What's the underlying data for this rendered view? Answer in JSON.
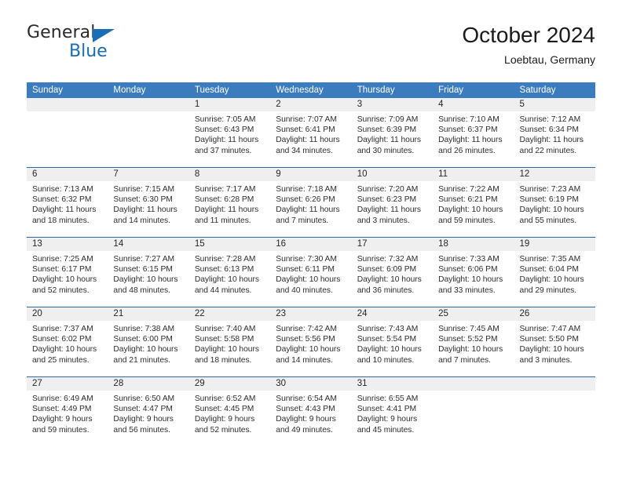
{
  "logo": {
    "word_dark": "General",
    "word_blue": "Blue",
    "triangle_color": "#1a6eb5"
  },
  "header": {
    "title": "October 2024",
    "subtitle": "Loebtau, Germany"
  },
  "theme": {
    "header_blue": "#3b7cbf",
    "divider_blue": "#2a66a8",
    "daynum_band": "#efefef",
    "text": "#2e2e2e"
  },
  "weekdays": [
    "Sunday",
    "Monday",
    "Tuesday",
    "Wednesday",
    "Thursday",
    "Friday",
    "Saturday"
  ],
  "weeks": [
    [
      {
        "day": "",
        "lines": []
      },
      {
        "day": "",
        "lines": []
      },
      {
        "day": "1",
        "lines": [
          "Sunrise: 7:05 AM",
          "Sunset: 6:43 PM",
          "Daylight: 11 hours",
          "and 37 minutes."
        ]
      },
      {
        "day": "2",
        "lines": [
          "Sunrise: 7:07 AM",
          "Sunset: 6:41 PM",
          "Daylight: 11 hours",
          "and 34 minutes."
        ]
      },
      {
        "day": "3",
        "lines": [
          "Sunrise: 7:09 AM",
          "Sunset: 6:39 PM",
          "Daylight: 11 hours",
          "and 30 minutes."
        ]
      },
      {
        "day": "4",
        "lines": [
          "Sunrise: 7:10 AM",
          "Sunset: 6:37 PM",
          "Daylight: 11 hours",
          "and 26 minutes."
        ]
      },
      {
        "day": "5",
        "lines": [
          "Sunrise: 7:12 AM",
          "Sunset: 6:34 PM",
          "Daylight: 11 hours",
          "and 22 minutes."
        ]
      }
    ],
    [
      {
        "day": "6",
        "lines": [
          "Sunrise: 7:13 AM",
          "Sunset: 6:32 PM",
          "Daylight: 11 hours",
          "and 18 minutes."
        ]
      },
      {
        "day": "7",
        "lines": [
          "Sunrise: 7:15 AM",
          "Sunset: 6:30 PM",
          "Daylight: 11 hours",
          "and 14 minutes."
        ]
      },
      {
        "day": "8",
        "lines": [
          "Sunrise: 7:17 AM",
          "Sunset: 6:28 PM",
          "Daylight: 11 hours",
          "and 11 minutes."
        ]
      },
      {
        "day": "9",
        "lines": [
          "Sunrise: 7:18 AM",
          "Sunset: 6:26 PM",
          "Daylight: 11 hours",
          "and 7 minutes."
        ]
      },
      {
        "day": "10",
        "lines": [
          "Sunrise: 7:20 AM",
          "Sunset: 6:23 PM",
          "Daylight: 11 hours",
          "and 3 minutes."
        ]
      },
      {
        "day": "11",
        "lines": [
          "Sunrise: 7:22 AM",
          "Sunset: 6:21 PM",
          "Daylight: 10 hours",
          "and 59 minutes."
        ]
      },
      {
        "day": "12",
        "lines": [
          "Sunrise: 7:23 AM",
          "Sunset: 6:19 PM",
          "Daylight: 10 hours",
          "and 55 minutes."
        ]
      }
    ],
    [
      {
        "day": "13",
        "lines": [
          "Sunrise: 7:25 AM",
          "Sunset: 6:17 PM",
          "Daylight: 10 hours",
          "and 52 minutes."
        ]
      },
      {
        "day": "14",
        "lines": [
          "Sunrise: 7:27 AM",
          "Sunset: 6:15 PM",
          "Daylight: 10 hours",
          "and 48 minutes."
        ]
      },
      {
        "day": "15",
        "lines": [
          "Sunrise: 7:28 AM",
          "Sunset: 6:13 PM",
          "Daylight: 10 hours",
          "and 44 minutes."
        ]
      },
      {
        "day": "16",
        "lines": [
          "Sunrise: 7:30 AM",
          "Sunset: 6:11 PM",
          "Daylight: 10 hours",
          "and 40 minutes."
        ]
      },
      {
        "day": "17",
        "lines": [
          "Sunrise: 7:32 AM",
          "Sunset: 6:09 PM",
          "Daylight: 10 hours",
          "and 36 minutes."
        ]
      },
      {
        "day": "18",
        "lines": [
          "Sunrise: 7:33 AM",
          "Sunset: 6:06 PM",
          "Daylight: 10 hours",
          "and 33 minutes."
        ]
      },
      {
        "day": "19",
        "lines": [
          "Sunrise: 7:35 AM",
          "Sunset: 6:04 PM",
          "Daylight: 10 hours",
          "and 29 minutes."
        ]
      }
    ],
    [
      {
        "day": "20",
        "lines": [
          "Sunrise: 7:37 AM",
          "Sunset: 6:02 PM",
          "Daylight: 10 hours",
          "and 25 minutes."
        ]
      },
      {
        "day": "21",
        "lines": [
          "Sunrise: 7:38 AM",
          "Sunset: 6:00 PM",
          "Daylight: 10 hours",
          "and 21 minutes."
        ]
      },
      {
        "day": "22",
        "lines": [
          "Sunrise: 7:40 AM",
          "Sunset: 5:58 PM",
          "Daylight: 10 hours",
          "and 18 minutes."
        ]
      },
      {
        "day": "23",
        "lines": [
          "Sunrise: 7:42 AM",
          "Sunset: 5:56 PM",
          "Daylight: 10 hours",
          "and 14 minutes."
        ]
      },
      {
        "day": "24",
        "lines": [
          "Sunrise: 7:43 AM",
          "Sunset: 5:54 PM",
          "Daylight: 10 hours",
          "and 10 minutes."
        ]
      },
      {
        "day": "25",
        "lines": [
          "Sunrise: 7:45 AM",
          "Sunset: 5:52 PM",
          "Daylight: 10 hours",
          "and 7 minutes."
        ]
      },
      {
        "day": "26",
        "lines": [
          "Sunrise: 7:47 AM",
          "Sunset: 5:50 PM",
          "Daylight: 10 hours",
          "and 3 minutes."
        ]
      }
    ],
    [
      {
        "day": "27",
        "lines": [
          "Sunrise: 6:49 AM",
          "Sunset: 4:49 PM",
          "Daylight: 9 hours",
          "and 59 minutes."
        ]
      },
      {
        "day": "28",
        "lines": [
          "Sunrise: 6:50 AM",
          "Sunset: 4:47 PM",
          "Daylight: 9 hours",
          "and 56 minutes."
        ]
      },
      {
        "day": "29",
        "lines": [
          "Sunrise: 6:52 AM",
          "Sunset: 4:45 PM",
          "Daylight: 9 hours",
          "and 52 minutes."
        ]
      },
      {
        "day": "30",
        "lines": [
          "Sunrise: 6:54 AM",
          "Sunset: 4:43 PM",
          "Daylight: 9 hours",
          "and 49 minutes."
        ]
      },
      {
        "day": "31",
        "lines": [
          "Sunrise: 6:55 AM",
          "Sunset: 4:41 PM",
          "Daylight: 9 hours",
          "and 45 minutes."
        ]
      },
      {
        "day": "",
        "lines": []
      },
      {
        "day": "",
        "lines": []
      }
    ]
  ]
}
